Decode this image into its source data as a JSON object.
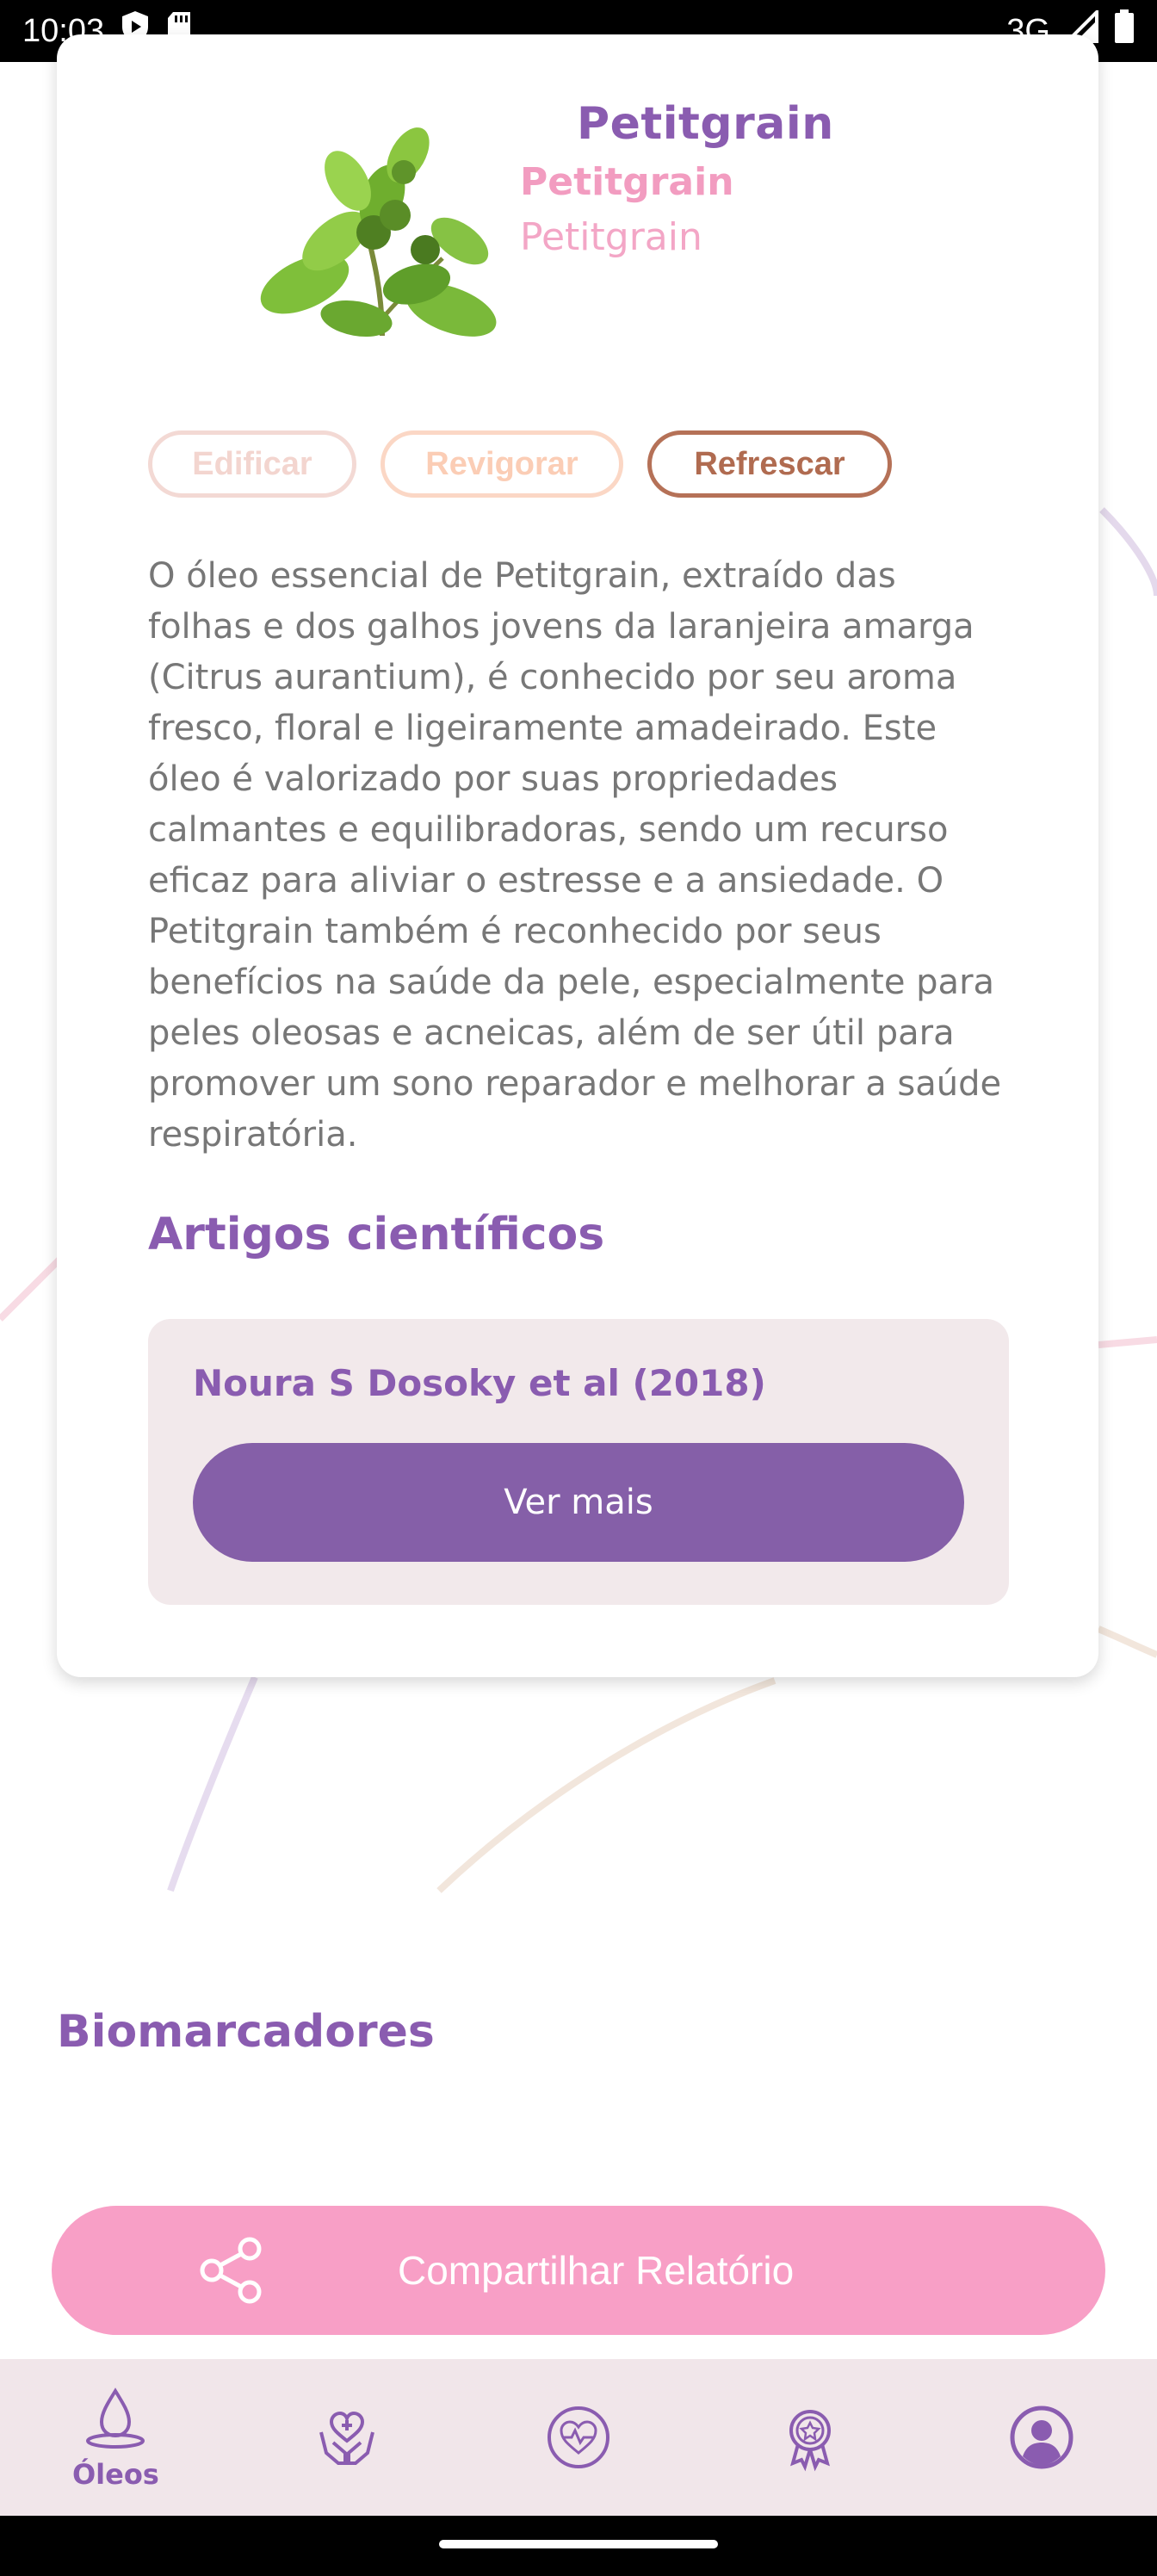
{
  "status_bar": {
    "time": "10:03",
    "network": "3G",
    "icons": [
      "play-protect-icon",
      "sd-card-icon",
      "signal-icon",
      "battery-icon"
    ]
  },
  "oil": {
    "title": "Petitgrain",
    "name_bold": "Petitgrain",
    "name_light": "Petitgrain",
    "image": "petitgrain-plant-image",
    "tags": [
      "Edificar",
      "Revigorar",
      "Refrescar"
    ],
    "description": "O óleo essencial de Petitgrain, extraído das folhas e dos galhos jovens da laranjeira amarga (Citrus aurantium), é conhecido por seu aroma fresco, floral e ligeiramente amadeirado. Este óleo é valorizado por suas propriedades calmantes e equilibradoras, sendo um recurso eficaz para aliviar o estresse e a ansiedade. O Petitgrain também é reconhecido por seus benefícios na saúde da pele, especialmente para peles oleosas e acneicas, além de ser útil para promover um sono reparador e melhorar a saúde respiratória."
  },
  "articles": {
    "section_title": "Artigos científicos",
    "items": [
      {
        "author": "Noura S Dosoky et al (2018)",
        "button": "Ver mais"
      }
    ]
  },
  "biomarkers": {
    "section_title": "Biomarcadores"
  },
  "share": {
    "label": "Compartilhar Relatório",
    "icon": "share-icon"
  },
  "bottom_nav": {
    "items": [
      {
        "label": "Óleos",
        "icon": "oil-drop-icon",
        "active": true
      },
      {
        "label": "",
        "icon": "care-hands-icon",
        "active": false
      },
      {
        "label": "",
        "icon": "heart-pulse-icon",
        "active": false
      },
      {
        "label": "",
        "icon": "award-badge-icon",
        "active": false
      },
      {
        "label": "",
        "icon": "profile-icon",
        "active": false
      }
    ]
  },
  "colors": {
    "brand_purple": "#8a5cb0",
    "button_purple": "#855fa8",
    "pink": "#f89fc6",
    "nav_bg": "#f1e6ea",
    "article_bg": "#f2e9eb"
  }
}
